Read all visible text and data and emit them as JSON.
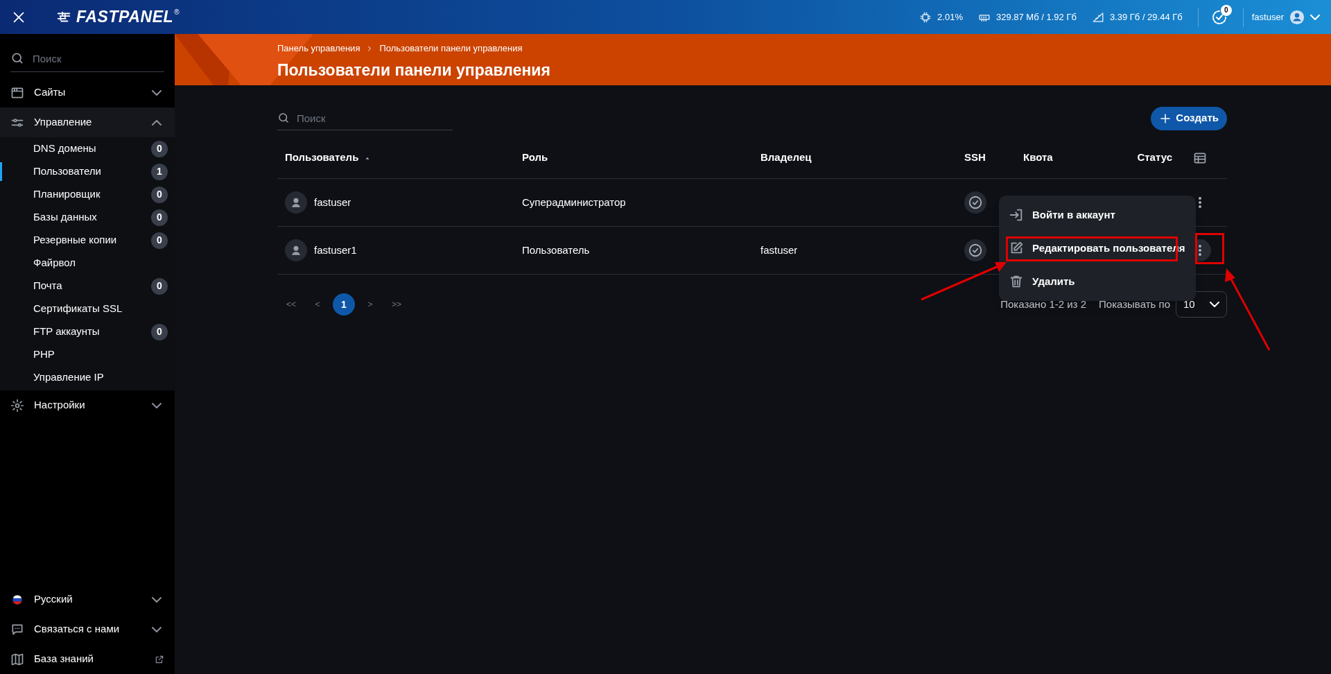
{
  "topbar": {
    "logo": "FASTPANEL",
    "logo_mark": "®",
    "stats": [
      {
        "kind": "cpu",
        "value": "2.01%"
      },
      {
        "kind": "ram",
        "value": "329.87 Мб / 1.92 Гб"
      },
      {
        "kind": "disk",
        "value": "3.39 Гб / 29.44 Гб"
      }
    ],
    "notifications": "0",
    "user": "fastuser"
  },
  "sidebar": {
    "search": {
      "placeholder": "Поиск"
    },
    "sections": [
      {
        "kind": "sites",
        "label": "Сайты",
        "expanded": false
      },
      {
        "kind": "manage",
        "label": "Управление",
        "expanded": true,
        "children": [
          {
            "label": "DNS домены",
            "count": "0",
            "selected": false
          },
          {
            "label": "Пользователи",
            "count": "1",
            "selected": true
          },
          {
            "label": "Планировщик",
            "count": "0",
            "selected": false
          },
          {
            "label": "Базы данных",
            "count": "0",
            "selected": false
          },
          {
            "label": "Резервные копии",
            "count": "0",
            "selected": false
          },
          {
            "label": "Файрвол",
            "selected": false
          },
          {
            "label": "Почта",
            "count": "0",
            "selected": false
          },
          {
            "label": "Сертификаты SSL",
            "selected": false
          },
          {
            "label": "FTP аккаунты",
            "count": "0",
            "selected": false
          },
          {
            "label": "PHP",
            "selected": false
          },
          {
            "label": "Управление IP",
            "selected": false
          }
        ]
      },
      {
        "kind": "settings",
        "label": "Настройки",
        "expanded": false
      }
    ],
    "footer": [
      {
        "kind": "language",
        "label": "Русский"
      },
      {
        "kind": "contact",
        "label": "Связаться с нами"
      },
      {
        "kind": "knowledge",
        "label": "База знаний"
      }
    ]
  },
  "header": {
    "breadcrumbs": [
      "Панель управления",
      "Пользователи панели управления"
    ],
    "title": "Пользователи панели управления"
  },
  "toolbar": {
    "search": {
      "placeholder": "Поиск"
    },
    "create_button": "Создать"
  },
  "table": {
    "columns": [
      "Пользователь",
      "Роль",
      "Владелец",
      "SSH",
      "Квота",
      "Статус"
    ],
    "rows": [
      {
        "user": "fastuser",
        "role": "Суперадминистратор",
        "ssh": true
      },
      {
        "user": "fastuser1",
        "role": "Пользователь",
        "owner": "fastuser",
        "ssh": true
      }
    ]
  },
  "pagination": {
    "pages": [
      {
        "label": "<<",
        "selected": false
      },
      {
        "label": "<",
        "selected": false
      },
      {
        "label": "1",
        "selected": true
      },
      {
        "label": ">",
        "selected": false
      },
      {
        "label": ">>",
        "selected": false
      }
    ],
    "shown": "Показано 1-2 из 2",
    "per_page_label": "Показывать по",
    "per_page": "10"
  },
  "context_menu": [
    {
      "kind": "login",
      "label": "Войти в аккаунт"
    },
    {
      "kind": "edit",
      "label": "Редактировать пользователя"
    },
    {
      "kind": "delete",
      "label": "Удалить"
    }
  ]
}
